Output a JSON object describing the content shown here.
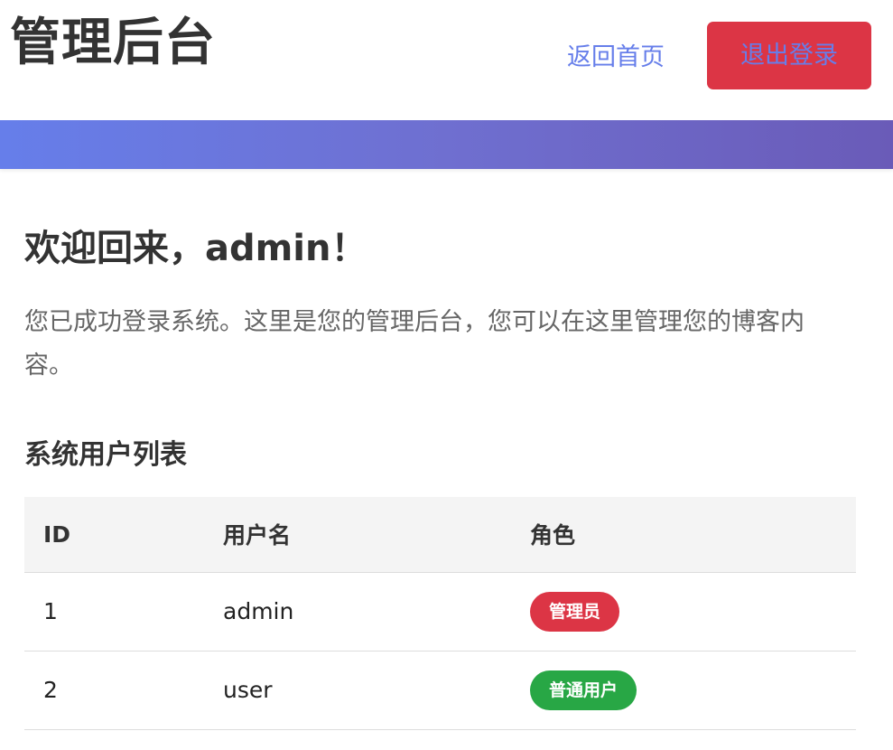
{
  "header": {
    "title": "管理后台",
    "home_link": "返回首页",
    "logout_label": "退出登录"
  },
  "main": {
    "welcome_title": "欢迎回来，admin！",
    "welcome_text": "您已成功登录系统。这里是您的管理后台，您可以在这里管理您的博客内容。",
    "section_title": "系统用户列表"
  },
  "table": {
    "headers": [
      "ID",
      "用户名",
      "角色"
    ],
    "rows": [
      {
        "id": "1",
        "username": "admin",
        "role": "管理员",
        "role_color": "#dc3545"
      },
      {
        "id": "2",
        "username": "user",
        "role": "普通用户",
        "role_color": "#28a745"
      }
    ]
  },
  "colors": {
    "accent": "#667eea",
    "banner_end": "#6a5bb8",
    "danger": "#dc3545",
    "success": "#28a745"
  }
}
